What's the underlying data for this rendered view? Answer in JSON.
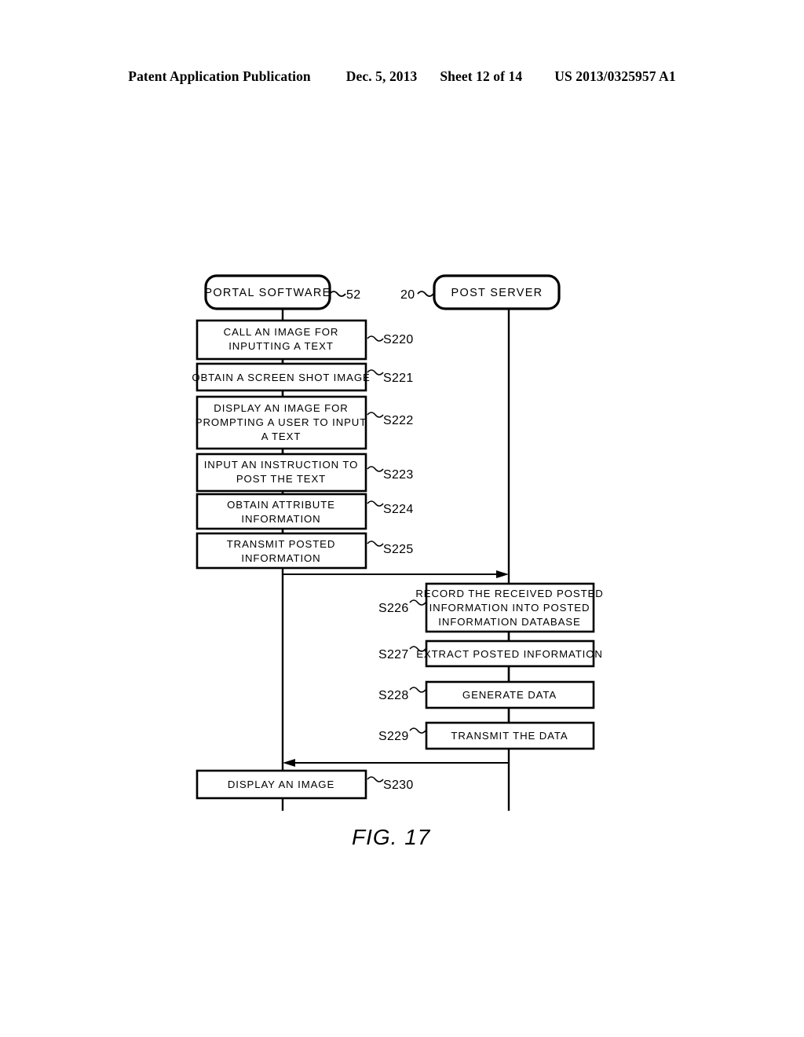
{
  "header": {
    "publication": "Patent Application Publication",
    "date": "Dec. 5, 2013",
    "sheet": "Sheet 12 of 14",
    "number": "US 2013/0325957 A1"
  },
  "figure": {
    "caption": "FIG. 17"
  },
  "lanes": [
    {
      "id": "portal",
      "label": "PORTAL SOFTWARE",
      "ref": "52"
    },
    {
      "id": "server",
      "label": "POST SERVER",
      "ref": "20"
    }
  ],
  "left_steps": [
    {
      "step": "S220",
      "lines": [
        "CALL AN IMAGE FOR",
        "INPUTTING A TEXT"
      ]
    },
    {
      "step": "S221",
      "lines": [
        "OBTAIN A SCREEN SHOT IMAGE"
      ]
    },
    {
      "step": "S222",
      "lines": [
        "DISPLAY AN IMAGE FOR",
        "PROMPTING A USER TO INPUT",
        "A TEXT"
      ]
    },
    {
      "step": "S223",
      "lines": [
        "INPUT AN INSTRUCTION TO",
        "POST THE TEXT"
      ]
    },
    {
      "step": "S224",
      "lines": [
        "OBTAIN ATTRIBUTE",
        "INFORMATION"
      ]
    },
    {
      "step": "S225",
      "lines": [
        "TRANSMIT POSTED",
        "INFORMATION"
      ]
    }
  ],
  "right_steps": [
    {
      "step": "S226",
      "lines": [
        "RECORD THE RECEIVED POSTED",
        "INFORMATION INTO POSTED",
        "INFORMATION DATABASE"
      ]
    },
    {
      "step": "S227",
      "lines": [
        "EXTRACT POSTED INFORMATION"
      ]
    },
    {
      "step": "S228",
      "lines": [
        "GENERATE DATA"
      ]
    },
    {
      "step": "S229",
      "lines": [
        "TRANSMIT THE DATA"
      ]
    }
  ],
  "final_step": {
    "step": "S230",
    "lines": [
      "DISPLAY AN IMAGE"
    ]
  },
  "arrows": [
    {
      "id": "post-to-server",
      "direction": "right"
    },
    {
      "id": "server-to-portal",
      "direction": "left"
    }
  ],
  "colors": {
    "ink": "#000000",
    "paper": "#ffffff"
  }
}
